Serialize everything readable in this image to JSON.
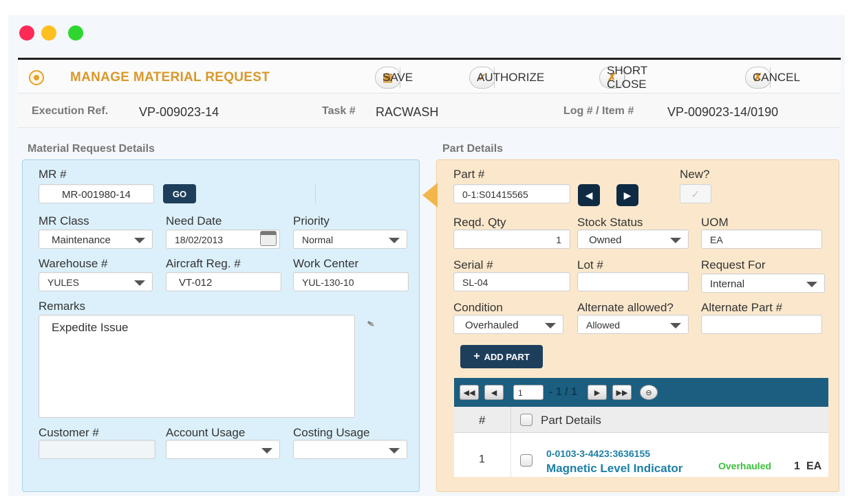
{
  "window": {
    "traffic_colors": [
      "#ff2a55",
      "#ffbf1f",
      "#2fd62f"
    ]
  },
  "toolbar": {
    "title": "MANAGE MATERIAL REQUEST",
    "save_label": "SAVE",
    "authorize_label": "AUTHORIZE",
    "short_close_label": "SHORT CLOSE",
    "cancel_label": "CANCEL"
  },
  "refbar": {
    "execution_ref_label": "Execution Ref.",
    "execution_ref_value": "VP-009023-14",
    "task_label": "Task #",
    "task_value": "RACWASH",
    "log_label": "Log # / Item #",
    "log_value": "VP-009023-14/0190"
  },
  "material_request": {
    "section_title": "Material Request Details",
    "mr_label": "MR #",
    "mr_value": "MR-001980-14",
    "go_label": "GO",
    "mr_class_label": "MR Class",
    "mr_class_value": "Maintenance",
    "need_date_label": "Need Date",
    "need_date_value": "18/02/2013",
    "priority_label": "Priority",
    "priority_value": "Normal",
    "warehouse_label": "Warehouse #",
    "warehouse_value": "YULES",
    "aircraft_label": "Aircraft Reg. #",
    "aircraft_value": "VT-012",
    "work_center_label": "Work Center",
    "work_center_value": "YUL-130-10",
    "remarks_label": "Remarks",
    "remarks_value": "Expedite Issue",
    "customer_label": "Customer #",
    "customer_value": "",
    "account_usage_label": "Account Usage",
    "account_usage_value": "",
    "costing_usage_label": "Costing Usage",
    "costing_usage_value": ""
  },
  "part_details": {
    "section_title": "Part Details",
    "part_label": "Part #",
    "part_value": "0-1:S01415565",
    "new_label": "New?",
    "reqd_qty_label": "Reqd. Qty",
    "reqd_qty_value": "1",
    "stock_status_label": "Stock Status",
    "stock_status_value": "Owned",
    "uom_label": "UOM",
    "uom_value": "EA",
    "serial_label": "Serial #",
    "serial_value": "SL-04",
    "lot_label": "Lot #",
    "lot_value": "",
    "request_for_label": "Request For",
    "request_for_value": "Internal",
    "condition_label": "Condition",
    "condition_value": "Overhauled",
    "alternate_allowed_label": "Alternate allowed?",
    "alternate_allowed_value": "Allowed",
    "alternate_part_label": "Alternate Part #",
    "alternate_part_value": "",
    "add_part_label": "ADD PART"
  },
  "grid": {
    "page_value": "1",
    "page_count": "- 1 / 1",
    "col_number": "#",
    "col_part_details": "Part Details",
    "rows": [
      {
        "number": "1",
        "part_no": "0-0103-3-4423:3636155",
        "part_name": "Magnetic Level Indicator",
        "condition": "Overhauled",
        "qty": "1",
        "uom": "EA"
      }
    ]
  }
}
